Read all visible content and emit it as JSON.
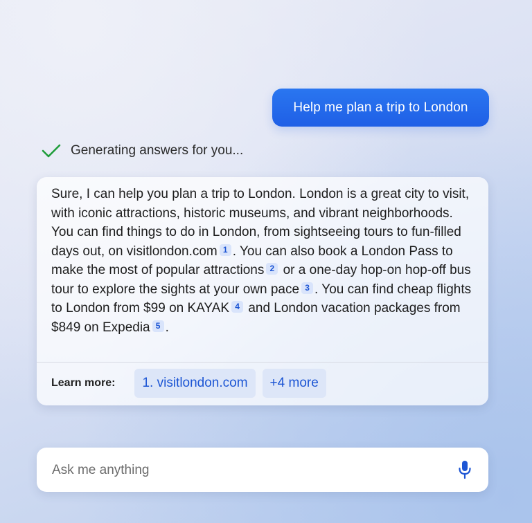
{
  "user_message": "Help me plan a trip to London",
  "status": {
    "icon": "check-icon",
    "text": "Generating answers for you..."
  },
  "answer": {
    "segments": [
      "Sure, I can help you plan a trip to London. London is a great city to visit, with iconic attractions, historic museums, and vibrant neighborhoods. You can find things to do in London, from sightseeing tours to fun-filled days out, on visitlondon.com",
      ". You can also book a London Pass to make the most of popular attractions",
      "or a one-day hop-on hop-off bus tour to explore the sights at your own pace",
      ". You can find cheap flights to London from $99 on KAYAK",
      "and London vacation packages from $849 on Expedia",
      "."
    ],
    "citations": [
      "1",
      "2",
      "3",
      "4",
      "5"
    ]
  },
  "learn_more": {
    "label": "Learn more:",
    "links": [
      "1. visitlondon.com",
      "+4 more"
    ]
  },
  "ask": {
    "placeholder": "Ask me anything",
    "value": "",
    "mic_icon": "microphone-icon"
  },
  "colors": {
    "accent": "#1f5fe6",
    "citation_bg": "#d9e4fb",
    "citation_text": "#1c55d4",
    "check_green": "#1f9d3a",
    "mic_blue": "#1c55d4"
  }
}
